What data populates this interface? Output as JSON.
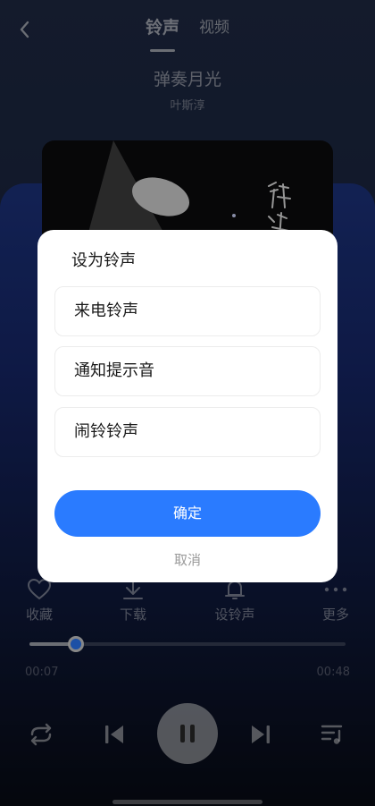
{
  "header": {
    "tabs": [
      {
        "label": "铃声",
        "active": true
      },
      {
        "label": "视频",
        "active": false
      }
    ]
  },
  "song": {
    "title": "弹奏月光",
    "artist": "叶斯淳"
  },
  "actions": [
    {
      "label": "收藏",
      "icon": "heart-icon"
    },
    {
      "label": "下载",
      "icon": "download-icon"
    },
    {
      "label": "设铃声",
      "icon": "bell-icon"
    },
    {
      "label": "更多",
      "icon": "more-icon"
    }
  ],
  "player": {
    "current_time": "00:07",
    "total_time": "00:48",
    "progress_fraction": 0.146
  },
  "dialog": {
    "title": "设为铃声",
    "options": [
      {
        "label": "来电铃声"
      },
      {
        "label": "通知提示音"
      },
      {
        "label": "闹铃铃声"
      }
    ],
    "confirm_label": "确定",
    "cancel_label": "取消"
  },
  "colors": {
    "accent": "#2a7bff",
    "dialog_bg": "#ffffff"
  }
}
